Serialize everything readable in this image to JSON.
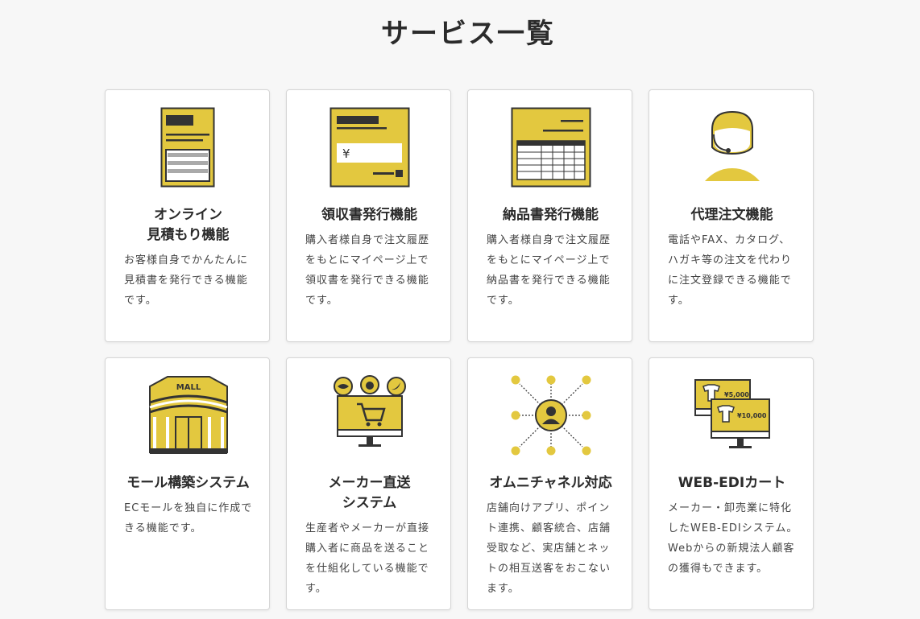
{
  "page": {
    "title": "サービス一覧"
  },
  "colors": {
    "accent": "#e3c83f",
    "ink": "#333333",
    "background": "#f7f7f7"
  },
  "cards": [
    {
      "icon": "estimate-document-icon",
      "title": "オンライン\n見積もり機能",
      "description": "お客様自身でかんたんに見積書を発行できる機能です。"
    },
    {
      "icon": "receipt-icon",
      "title": "領収書発行機能",
      "description": "購入者様自身で注文履歴をもとにマイページ上で領収書を発行できる機能です。"
    },
    {
      "icon": "delivery-slip-icon",
      "title": "納品書発行機能",
      "description": "購入者様自身で注文履歴をもとにマイページ上で納品書を発行できる機能です。"
    },
    {
      "icon": "operator-headset-icon",
      "title": "代理注文機能",
      "description": "電話やFAX、カタログ、ハガキ等の注文を代わりに注文登録できる機能です。"
    },
    {
      "icon": "mall-building-icon",
      "title": "モール構築システム",
      "description": "ECモールを独自に作成できる機能です。",
      "icon_text": "MALL"
    },
    {
      "icon": "monitor-cart-icon",
      "title": "メーカー直送\nシステム",
      "description": "生産者やメーカーが直接購入者に商品を送ることを仕組化している機能です。"
    },
    {
      "icon": "omni-network-icon",
      "title": "オムニチャネル対応",
      "description": "店舗向けアプリ、ポイント連携、顧客統合、店舗受取など、実店舗とネットの相互送客をおこないます。"
    },
    {
      "icon": "web-edi-monitors-icon",
      "title": "WEB-EDIカート",
      "description": "メーカー・卸売業に特化したWEB-EDIシステム。Webからの新規法人顧客の獲得もできます。",
      "icon_prices": [
        "¥5,000",
        "¥10,000"
      ]
    }
  ]
}
